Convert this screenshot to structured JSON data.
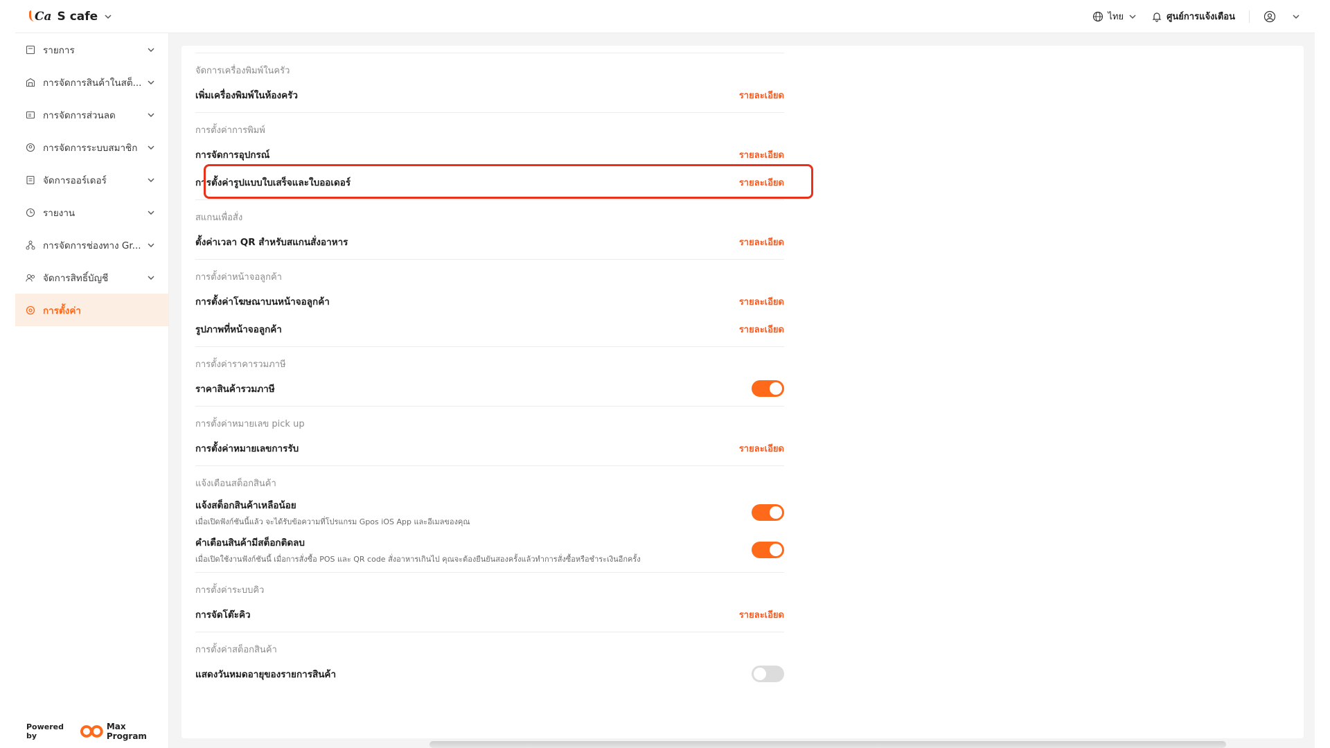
{
  "app": {
    "logo_text": "Ca",
    "name": "S cafe"
  },
  "header": {
    "language": "ไทย",
    "notifications_label": "ศูนย์การแจ้งเตือน"
  },
  "sidebar": {
    "items": [
      {
        "label": "รายการ",
        "icon": "list-icon"
      },
      {
        "label": "การจัดการสินค้าในสต็...",
        "icon": "warehouse-icon"
      },
      {
        "label": "การจัดการส่วนลด",
        "icon": "discount-icon"
      },
      {
        "label": "การจัดการระบบสมาชิก",
        "icon": "member-icon"
      },
      {
        "label": "จัดการออร์เดอร์",
        "icon": "order-icon"
      },
      {
        "label": "รายงาน",
        "icon": "report-icon"
      },
      {
        "label": "การจัดการช่องทาง Gr...",
        "icon": "channel-icon"
      },
      {
        "label": "จัดการสิทธิ์บัญชี",
        "icon": "account-icon"
      },
      {
        "label": "การตั้งค่า",
        "icon": "settings-icon",
        "active": true
      }
    ],
    "powered_by": "Powered by",
    "powered_logo": "Max Program"
  },
  "sections": [
    {
      "title": "จัดการเครื่องพิมพ์ในครัว",
      "rows": [
        {
          "label": "เพิ่มเครื่องพิมพ์ในห้องครัว",
          "action": "รายละเอียด"
        }
      ]
    },
    {
      "title": "การตั้งค่าการพิมพ์",
      "rows": [
        {
          "label": "การจัดการอุปกรณ์",
          "action": "รายละเอียด"
        },
        {
          "label": "การตั้งค่ารูปแบบใบเสร็จและใบออเดอร์",
          "action": "รายละเอียด"
        }
      ]
    },
    {
      "title": "สแกนเพื่อสั่ง",
      "rows": [
        {
          "label": "ตั้งค่าเวลา QR สำหรับสแกนสั่งอาหาร",
          "action": "รายละเอียด"
        }
      ]
    },
    {
      "title": "การตั้งค่าหน้าจอลูกค้า",
      "rows": [
        {
          "label": "การตั้งค่าโฆษณาบนหน้าจอลูกค้า",
          "action": "รายละเอียด"
        },
        {
          "label": "รูปภาพที่หน้าจอลูกค้า",
          "action": "รายละเอียด"
        }
      ]
    },
    {
      "title": "การตั้งค่าราคารวมภาษี",
      "rows": [
        {
          "label": "ราคาสินค้ารวมภาษี",
          "toggle": true
        }
      ]
    },
    {
      "title": "การตั้งค่าหมายเลข pick up",
      "rows": [
        {
          "label": "การตั้งค่าหมายเลขการรับ",
          "action": "รายละเอียด"
        }
      ]
    },
    {
      "title": "แจ้งเตือนสต็อกสินค้า",
      "rows": [
        {
          "label": "แจ้งสต็อกสินค้าเหลือน้อย",
          "desc": "เมื่อเปิดฟังก์ชันนี้แล้ว จะได้รับข้อความที่โปรแกรม Gpos iOS App และอีเมลของคุณ",
          "toggle": true
        },
        {
          "label": "คำเตือนสินค้ามีสต็อกติดลบ",
          "desc": "เมื่อเปิดใช้งานฟังก์ชันนี้ เมื่อการสั่งซื้อ POS และ QR code สั่งอาหารเกินไป คุณจะต้องยืนยันสองครั้งแล้วทำการสั่งซื้อหรือชำระเงินอีกครั้ง",
          "toggle": true
        }
      ]
    },
    {
      "title": "การตั้งค่าระบบคิว",
      "rows": [
        {
          "label": "การจัดโต๊ะคิว",
          "action": "รายละเอียด"
        }
      ]
    },
    {
      "title": "การตั้งค่าสต็อกสินค้า",
      "rows": [
        {
          "label": "แสดงวันหมดอายุของรายการสินค้า",
          "toggle": false
        }
      ]
    }
  ],
  "colors": {
    "accent": "#ff6a1a",
    "highlight_border": "#e8311a",
    "toggle_off": "#dcdcdc"
  }
}
